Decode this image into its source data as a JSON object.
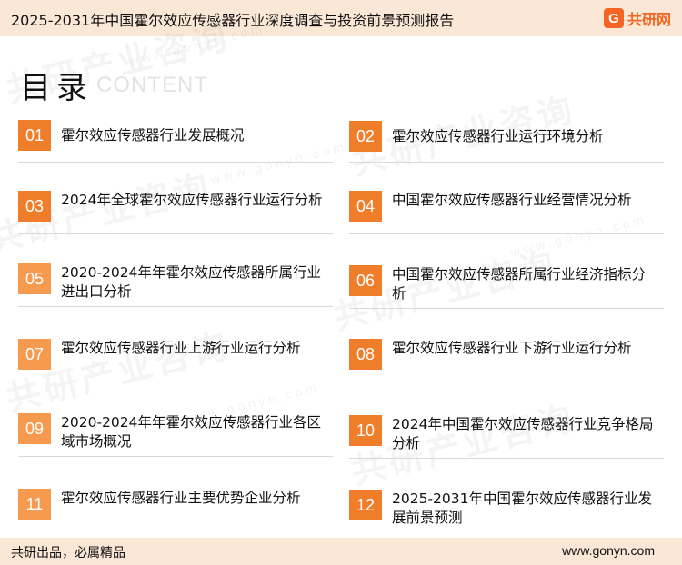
{
  "header": {
    "title": "2025-2031年中国霍尔效应传感器行业深度调查与投资前景预测报告",
    "brand_badge": "G",
    "brand_name": "共研网"
  },
  "toc": {
    "title": "目录",
    "subtitle": "CONTENT"
  },
  "watermark": {
    "text": "共研产业咨询",
    "url": "www.gonyn.com"
  },
  "items": [
    {
      "num": "01",
      "label": "霍尔效应传感器行业发展概况"
    },
    {
      "num": "02",
      "label": "霍尔效应传感器行业运行环境分析"
    },
    {
      "num": "03",
      "label": "2024年全球霍尔效应传感器行业运行分析"
    },
    {
      "num": "04",
      "label": "中国霍尔效应传感器行业经营情况分析"
    },
    {
      "num": "05",
      "label": "2020-2024年年霍尔效应传感器所属行业进出口分析"
    },
    {
      "num": "06",
      "label": "中国霍尔效应传感器所属行业经济指标分析"
    },
    {
      "num": "07",
      "label": "霍尔效应传感器行业上游行业运行分析"
    },
    {
      "num": "08",
      "label": "霍尔效应传感器行业下游行业运行分析"
    },
    {
      "num": "09",
      "label": "2020-2024年年霍尔效应传感器行业各区域市场概况"
    },
    {
      "num": "10",
      "label": "2024年中国霍尔效应传感器行业竞争格局分析"
    },
    {
      "num": "11",
      "label": "霍尔效应传感器行业主要优势企业分析"
    },
    {
      "num": "12",
      "label": "2025-2031年中国霍尔效应传感器行业发展前景预测"
    }
  ],
  "footer": {
    "slogan": "共研出品，必属精品",
    "url": "www.gonyn.com"
  }
}
